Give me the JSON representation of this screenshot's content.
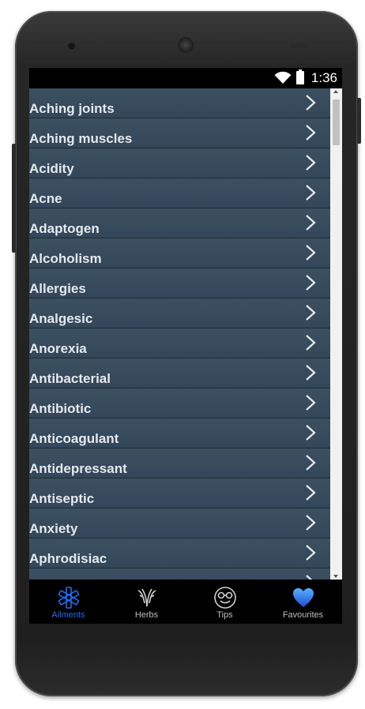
{
  "status": {
    "time": "1:36"
  },
  "list": {
    "items": [
      {
        "label": "Aching joints"
      },
      {
        "label": "Aching muscles"
      },
      {
        "label": "Acidity"
      },
      {
        "label": "Acne"
      },
      {
        "label": "Adaptogen"
      },
      {
        "label": "Alcoholism"
      },
      {
        "label": "Allergies"
      },
      {
        "label": "Analgesic"
      },
      {
        "label": "Anorexia"
      },
      {
        "label": "Antibacterial"
      },
      {
        "label": "Antibiotic"
      },
      {
        "label": "Anticoagulant"
      },
      {
        "label": "Antidepressant"
      },
      {
        "label": "Antiseptic"
      },
      {
        "label": "Anxiety"
      },
      {
        "label": "Aphrodisiac"
      }
    ]
  },
  "tabs": [
    {
      "label": "Ailments",
      "icon": "star-of-life-icon",
      "active": true
    },
    {
      "label": "Herbs",
      "icon": "herb-leaf-icon",
      "active": false
    },
    {
      "label": "Tips",
      "icon": "smiley-glasses-icon",
      "active": false
    },
    {
      "label": "Favourites",
      "icon": "heart-icon",
      "active": false
    }
  ],
  "colors": {
    "accent": "#1e6cf0",
    "list_bg": "#34495a",
    "tab_bg": "#000000"
  }
}
